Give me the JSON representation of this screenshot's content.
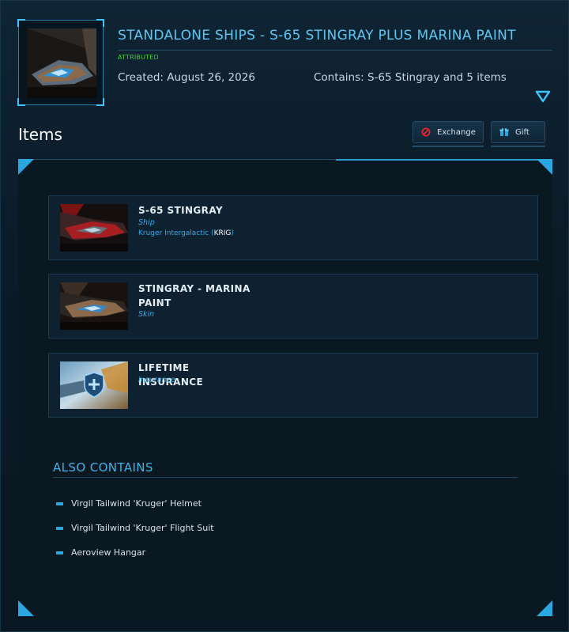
{
  "header": {
    "title": "STANDALONE SHIPS - S-65 STINGRAY PLUS MARINA PAINT",
    "status": "ATTRIBUTED",
    "created": "Created: August 26, 2026",
    "contains": "Contains: S-65 Stingray and 5 items",
    "toggle_icon": "chevron-down-icon"
  },
  "items_section": {
    "title": "Items",
    "exchange_label": "Exchange",
    "gift_label": "Gift"
  },
  "items": [
    {
      "name": "S-65 STINGRAY",
      "type": "Ship",
      "manufacturer": "Kruger Intergalactic (",
      "manufacturer_code": "KRIG",
      "manufacturer_close": ")"
    },
    {
      "name": "STINGRAY - MARINA PAINT",
      "type": "Skin"
    },
    {
      "name": "LIFETIME INSURANCE",
      "type": "Insurance"
    }
  ],
  "also_contains": {
    "title": "ALSO CONTAINS",
    "entries": [
      "Virgil Tailwind 'Kruger' Helmet",
      "Virgil Tailwind 'Kruger' Flight Suit",
      "Aeroview Hangar"
    ]
  },
  "colors": {
    "accent": "#3ec4ff",
    "title": "#5cc6f2",
    "attributed": "#3fd42b",
    "type_text": "#34a9e6"
  }
}
